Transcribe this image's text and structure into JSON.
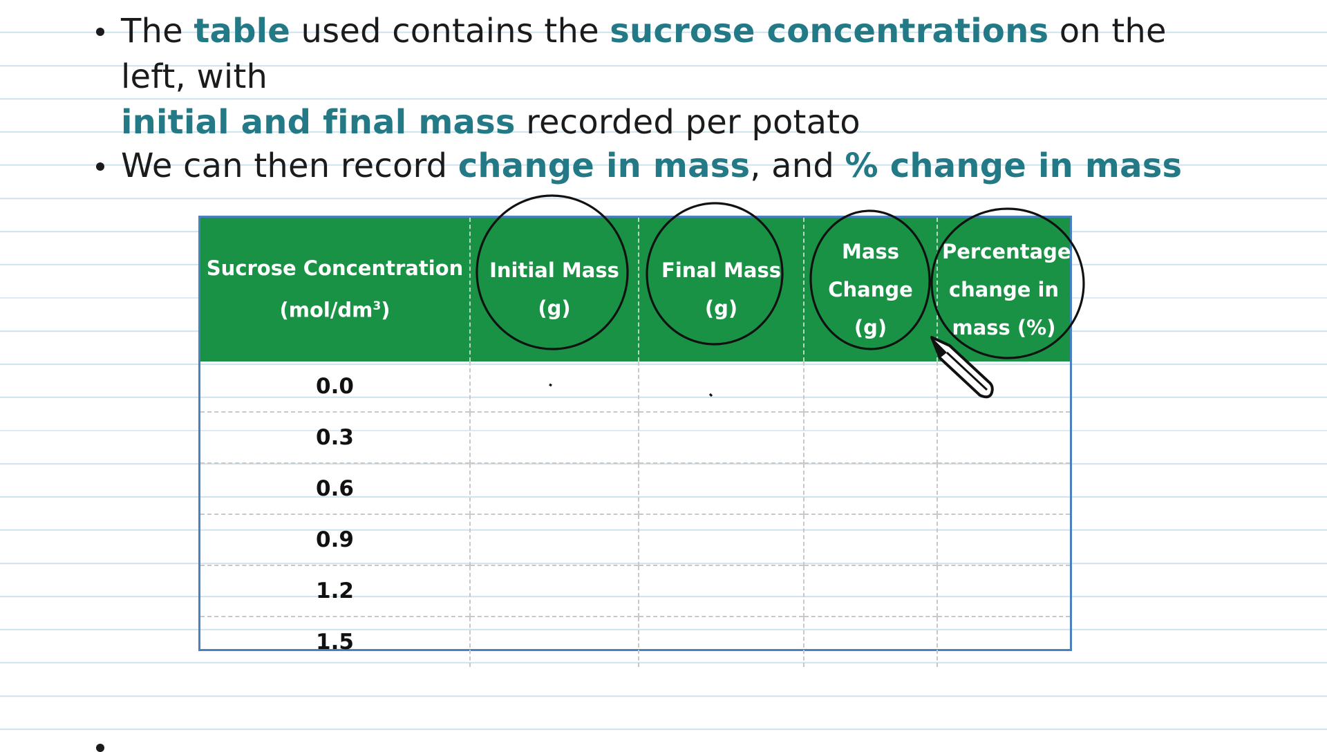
{
  "bullets": [
    {
      "segments": [
        {
          "text": "The ",
          "highlight": false
        },
        {
          "text": "table",
          "highlight": true
        },
        {
          "text": " used contains the ",
          "highlight": false
        },
        {
          "text": "sucrose concentrations",
          "highlight": true
        },
        {
          "text": " on the left, with ",
          "highlight": false
        },
        {
          "text": "initial and final mass",
          "highlight": true
        },
        {
          "text": " recorded per potato",
          "highlight": false
        }
      ]
    },
    {
      "segments": [
        {
          "text": "We can then record ",
          "highlight": false
        },
        {
          "text": "change in mass",
          "highlight": true
        },
        {
          "text": ", and ",
          "highlight": false
        },
        {
          "text": "% change in mass",
          "highlight": true
        }
      ]
    }
  ],
  "table": {
    "headers": [
      {
        "line1": "Sucrose Concentration",
        "line2": "(mol/dm",
        "sup": "3",
        "line2_end": ")"
      },
      {
        "line1": "Initial Mass",
        "line2": "(g)"
      },
      {
        "line1": "Final Mass",
        "line2": "(g)"
      },
      {
        "line1": "Mass",
        "line2": "Change",
        "line3": "(g)"
      },
      {
        "line1": "Percentage",
        "line2": "change in",
        "line3": "mass (%)"
      }
    ],
    "rows": [
      "0.0",
      "0.3",
      "0.6",
      "0.9",
      "1.2",
      "1.5"
    ]
  },
  "colors": {
    "accent_text": "#237a86",
    "header_bg": "#199245",
    "table_border": "#4a7fc0",
    "ruled_lines": "#cfe3ec"
  },
  "icons": [
    "pen-cursor-icon"
  ]
}
